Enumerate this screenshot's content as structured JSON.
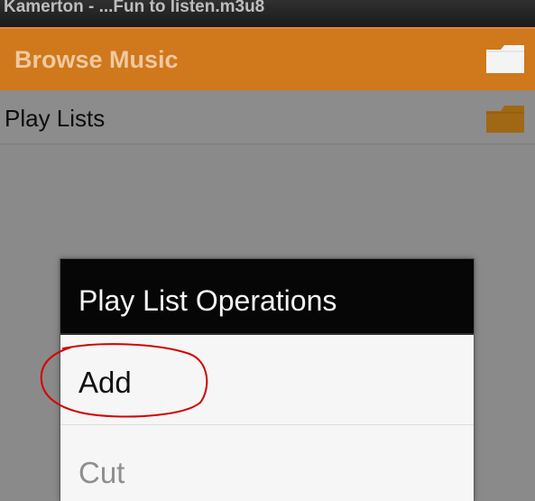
{
  "titlebar": {
    "title": "Kamerton - ...Fun to listen.m3u8"
  },
  "header": {
    "title": "Browse Music",
    "folder_icon": "folder-icon"
  },
  "list": {
    "items": [
      {
        "label": "Play Lists",
        "icon": "folder-icon"
      }
    ]
  },
  "dialog": {
    "title": "Play List Operations",
    "items": [
      {
        "label": "Add",
        "enabled": true
      },
      {
        "label": "Cut",
        "enabled": false
      }
    ]
  },
  "annotation": {
    "type": "hand-drawn-circle",
    "color": "#d40000",
    "target": "Add"
  },
  "colors": {
    "header_bg": "#d0781c",
    "header_text": "#f0c9a0",
    "dialog_title_bg": "#060606",
    "dialog_body_bg": "#f6f6f6"
  }
}
